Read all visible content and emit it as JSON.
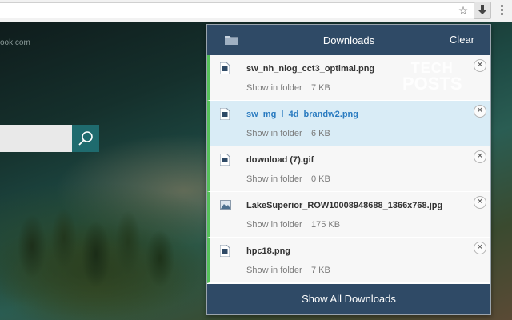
{
  "browser": {
    "url_fragment": "ook.com"
  },
  "downloads_panel": {
    "title": "Downloads",
    "clear_label": "Clear",
    "show_all_label": "Show All Downloads",
    "watermark": [
      "TECH",
      "POSTS"
    ],
    "items": [
      {
        "filename": "sw_nh_nlog_cct3_optimal.png",
        "action": "Show in folder",
        "size": "7 KB",
        "icon": "file-icon"
      },
      {
        "filename": "sw_mg_l_4d_brandw2.png",
        "action": "Show in folder",
        "size": "6 KB",
        "icon": "file-icon"
      },
      {
        "filename": "download (7).gif",
        "action": "Show in folder",
        "size": "0 KB",
        "icon": "file-icon"
      },
      {
        "filename": "LakeSuperior_ROW10008948688_1366x768.jpg",
        "action": "Show in folder",
        "size": "175 KB",
        "icon": "image-icon"
      },
      {
        "filename": "hpc18.png",
        "action": "Show in folder",
        "size": "7 KB",
        "icon": "file-icon"
      }
    ]
  },
  "colors": {
    "header_bg": "#2f4a66",
    "selected_bg": "#d9ecf6",
    "selected_text": "#2a7bc0",
    "status_bar": "#55c05a"
  }
}
